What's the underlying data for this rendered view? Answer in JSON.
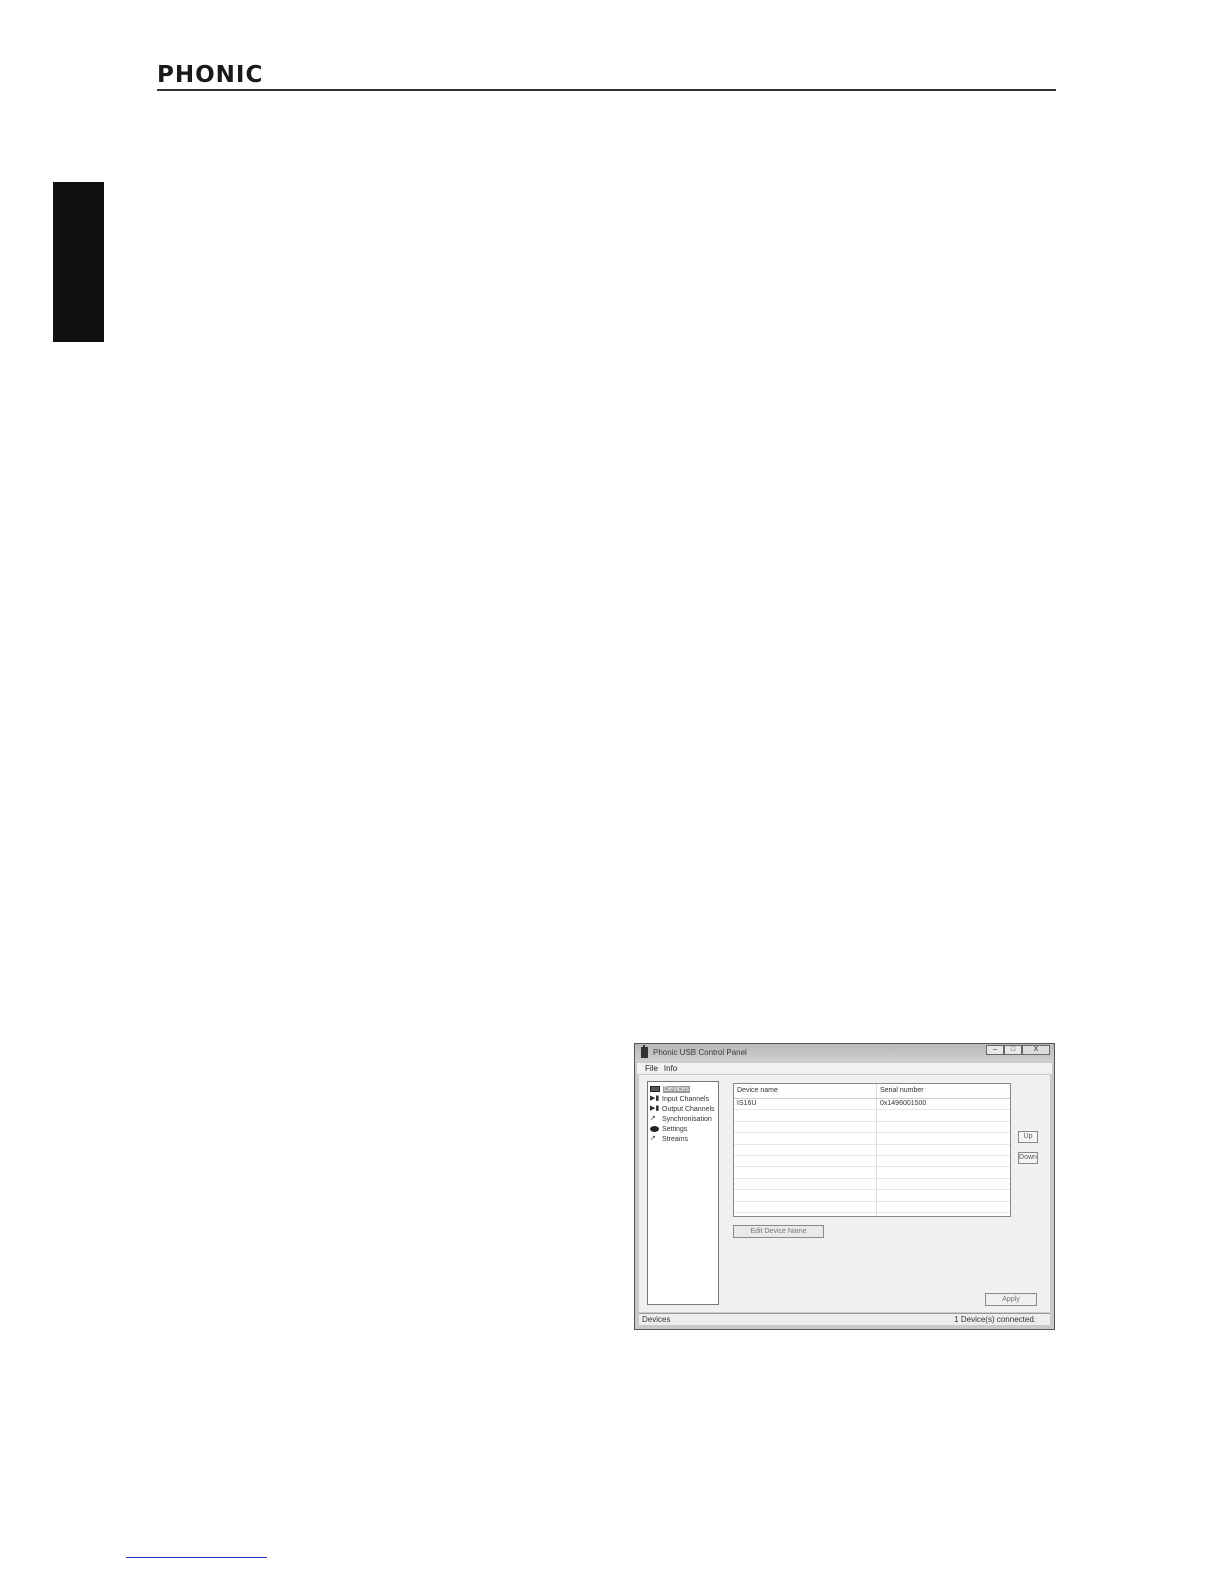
{
  "header": {
    "brand": "PHONIC"
  },
  "window": {
    "title": "Phonic USB Control Panel",
    "controls": {
      "minimize": "–",
      "maximize": "□",
      "close": "X"
    },
    "menu": [
      "File",
      "Info"
    ],
    "tree": [
      {
        "label": "Devices",
        "icon": "devices-icon",
        "selected": true
      },
      {
        "label": "Input Channels",
        "icon": "input-channels-icon"
      },
      {
        "label": "Output Channels",
        "icon": "output-channels-icon"
      },
      {
        "label": "Synchronisation",
        "icon": "synchronisation-icon"
      },
      {
        "label": "Settings",
        "icon": "settings-icon"
      },
      {
        "label": "Streams",
        "icon": "streams-icon"
      }
    ],
    "devices_table": {
      "columns": [
        "Device name",
        "Serial number"
      ],
      "rows": [
        [
          "IS16U",
          "0x1496001500"
        ]
      ]
    },
    "buttons": {
      "up": "Up",
      "down": "Down",
      "edit_device_name": "Edit Device Name",
      "apply": "Apply"
    },
    "status": {
      "left": "Devices",
      "right": "1 Device(s) connected."
    }
  }
}
